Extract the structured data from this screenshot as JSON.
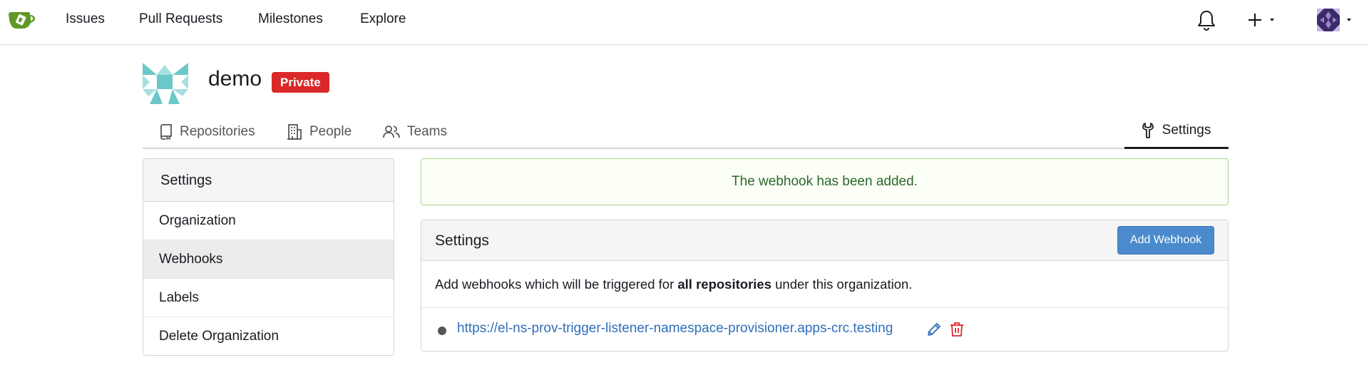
{
  "nav": {
    "logo_icon": "gitea-logo-icon",
    "items": [
      "Issues",
      "Pull Requests",
      "Milestones",
      "Explore"
    ],
    "right_icons": [
      "bell-icon",
      "plus-icon",
      "user-avatar"
    ]
  },
  "org": {
    "name": "demo",
    "badge": "Private",
    "badge_color": "#db2828"
  },
  "tabs": [
    {
      "label": "Repositories",
      "icon": "repo-icon"
    },
    {
      "label": "People",
      "icon": "building-icon"
    },
    {
      "label": "Teams",
      "icon": "people-icon"
    },
    {
      "label": "Settings",
      "icon": "tools-icon",
      "active": true
    }
  ],
  "sidebar": {
    "header": "Settings",
    "items": [
      {
        "label": "Organization"
      },
      {
        "label": "Webhooks",
        "active": true
      },
      {
        "label": "Labels"
      },
      {
        "label": "Delete Organization"
      }
    ]
  },
  "alert": {
    "message": "The webhook has been added.",
    "color": "#2c662d"
  },
  "panel": {
    "title": "Settings",
    "add_button": "Add Webhook",
    "desc_before": "Add webhooks which will be triggered for ",
    "desc_bold": "all repositories",
    "desc_after": " under this organization.",
    "webhooks": [
      {
        "url": "https://el-ns-prov-trigger-listener-namespace-provisioner.apps-crc.testing"
      }
    ],
    "link_color": "#2f6fba",
    "button_color": "#4b8acd"
  }
}
